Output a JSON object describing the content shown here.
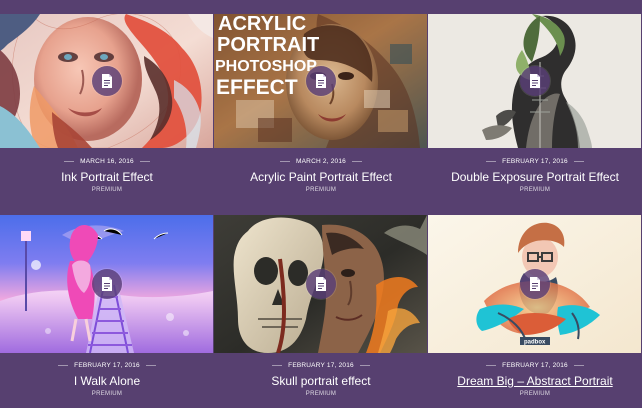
{
  "cards": [
    {
      "date": "MARCH 16, 2016",
      "title": "Ink Portrait Effect",
      "tag": "PREMIUM",
      "palette": [
        "#f7b3a5",
        "#e2523f",
        "#8bc1d3",
        "#5a2f2b",
        "#d7efe9"
      ],
      "icon": "document-icon"
    },
    {
      "date": "MARCH 2, 2016",
      "title": "Acrylic Paint Portrait Effect",
      "tag": "PREMIUM",
      "thumb_text": [
        "ACRYLIC",
        "PORTRAIT",
        "PHOTOSHOP",
        "EFFECT"
      ],
      "palette": [
        "#8e5a31",
        "#c79b6a",
        "#365058",
        "#e4d0b6",
        "#5b3121"
      ],
      "icon": "document-icon"
    },
    {
      "date": "FEBRUARY 17, 2016",
      "title": "Double Exposure Portrait Effect",
      "tag": "PREMIUM",
      "palette": [
        "#e8e6e0",
        "#2f2e2e",
        "#6b8f4f",
        "#9ea39b",
        "#c6c5bf"
      ],
      "icon": "document-icon"
    },
    {
      "date": "FEBRUARY 17, 2016",
      "title": "I Walk Alone",
      "tag": "PREMIUM",
      "palette": [
        "#4c6eea",
        "#ef4ab7",
        "#f3a9df",
        "#7d4dd8",
        "#fdd7f8"
      ],
      "icon": "document-icon"
    },
    {
      "date": "FEBRUARY 17, 2016",
      "title": "Skull portrait effect",
      "tag": "PREMIUM",
      "palette": [
        "#2c2c28",
        "#ddd1b8",
        "#f17b1f",
        "#7d2b1f",
        "#a0a08e"
      ],
      "icon": "document-icon"
    },
    {
      "date": "FEBRUARY 17, 2016",
      "title": "Dream Big – Abstract Portrait",
      "tag": "PREMIUM",
      "thumb_text": [
        "padbox"
      ],
      "palette": [
        "#f4e7cf",
        "#1fc3d5",
        "#db5d38",
        "#f3e6ee",
        "#394b62"
      ],
      "icon": "document-icon"
    }
  ]
}
